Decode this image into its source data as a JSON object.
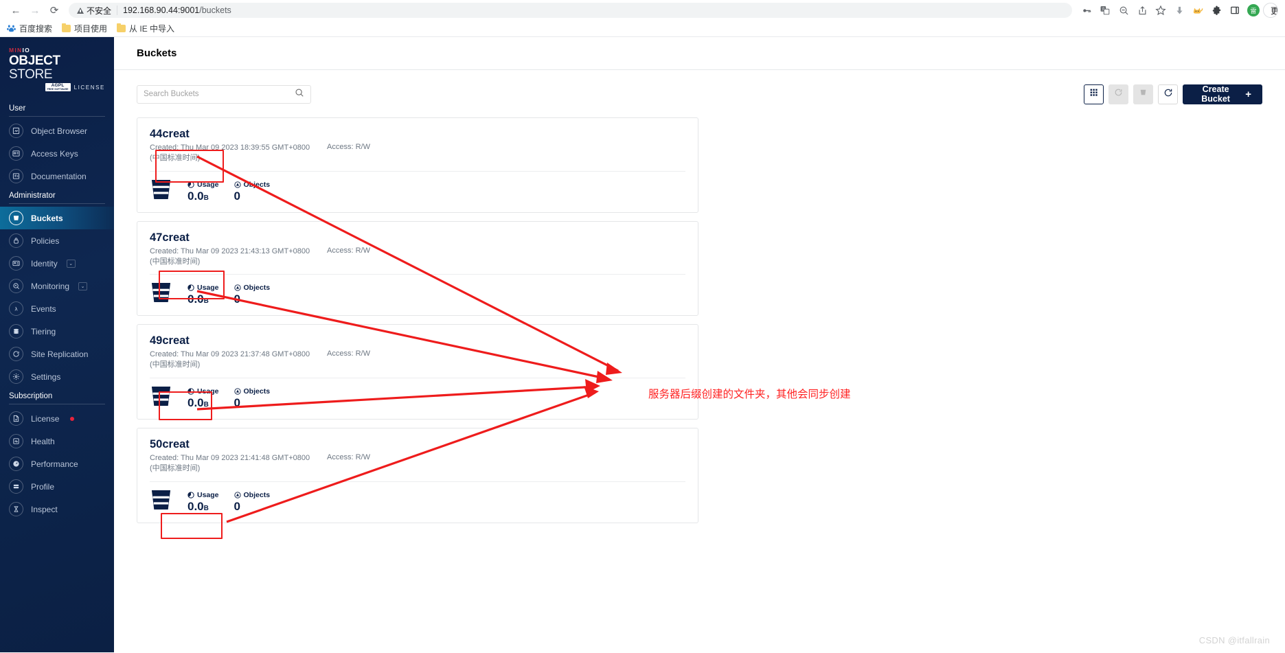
{
  "browser": {
    "nav": {
      "back": "←",
      "forward": "→",
      "reload": "⟳"
    },
    "omnibox": {
      "security_label": "不安全",
      "url_host": "192.168.90.44:9001",
      "url_path": "/buckets"
    },
    "toolbar_icons": [
      {
        "name": "password-key-icon",
        "glyph": "⚷"
      },
      {
        "name": "translate-icon",
        "glyph": "文"
      },
      {
        "name": "zoom-out-icon",
        "glyph": "⊖"
      },
      {
        "name": "share-icon",
        "glyph": "↗"
      },
      {
        "name": "bookmark-star-icon",
        "glyph": "☆"
      },
      {
        "name": "downloads-icon",
        "glyph": "⬇"
      },
      {
        "name": "cat-extension-icon",
        "glyph": "🐈"
      },
      {
        "name": "extensions-puzzle-icon",
        "glyph": "🧩"
      },
      {
        "name": "side-panel-icon",
        "glyph": "◫"
      },
      {
        "name": "profile-avatar-icon",
        "glyph": "雷"
      }
    ],
    "update_button": "更新",
    "bookmarks": [
      {
        "label": "百度搜索",
        "icon": "baidu-icon"
      },
      {
        "label": "项目使用",
        "icon": "folder-icon"
      },
      {
        "label": "从 IE 中导入",
        "icon": "folder-icon"
      }
    ]
  },
  "sidebar": {
    "logo": {
      "brand_small": "MINIO",
      "brand_bold": "OBJECT",
      "brand_light": "STORE",
      "badge": "AGPL",
      "badge_sub": "FREE SOFTWARE",
      "license": "LICENSE"
    },
    "sections": [
      {
        "title": "User",
        "items": [
          {
            "label": "Object Browser",
            "icon": "object-browser-icon",
            "active": false
          },
          {
            "label": "Access Keys",
            "icon": "access-keys-icon",
            "active": false
          },
          {
            "label": "Documentation",
            "icon": "documentation-icon",
            "active": false
          }
        ]
      },
      {
        "title": "Administrator",
        "items": [
          {
            "label": "Buckets",
            "icon": "bucket-icon",
            "active": true
          },
          {
            "label": "Policies",
            "icon": "policies-lock-icon",
            "active": false
          },
          {
            "label": "Identity",
            "icon": "identity-icon",
            "active": false,
            "expandable": true
          },
          {
            "label": "Monitoring",
            "icon": "monitoring-icon",
            "active": false,
            "expandable": true
          },
          {
            "label": "Events",
            "icon": "events-lambda-icon",
            "active": false
          },
          {
            "label": "Tiering",
            "icon": "tiering-layers-icon",
            "active": false
          },
          {
            "label": "Site Replication",
            "icon": "site-replication-icon",
            "active": false
          },
          {
            "label": "Settings",
            "icon": "settings-gear-icon",
            "active": false
          }
        ]
      },
      {
        "title": "Subscription",
        "items": [
          {
            "label": "License",
            "icon": "license-icon",
            "active": false,
            "badge_dot": true
          },
          {
            "label": "Health",
            "icon": "health-icon",
            "active": false
          },
          {
            "label": "Performance",
            "icon": "performance-icon",
            "active": false
          },
          {
            "label": "Profile",
            "icon": "profile-icon",
            "active": false
          },
          {
            "label": "Inspect",
            "icon": "inspect-icon",
            "active": false
          }
        ]
      }
    ]
  },
  "page": {
    "title": "Buckets"
  },
  "toolbar": {
    "search_placeholder": "Search Buckets",
    "search_value": "",
    "search_icon": "search-icon",
    "buttons": [
      {
        "name": "grid-view-button",
        "icon": "grid-icon",
        "state": "active"
      },
      {
        "name": "refresh-replication-button",
        "icon": "sync-icon",
        "state": "disabled"
      },
      {
        "name": "delete-bucket-button",
        "icon": "trash-bucket-icon",
        "state": "disabled"
      },
      {
        "name": "reload-button",
        "icon": "reload-icon",
        "state": "normal"
      }
    ],
    "create_label": "Create Bucket",
    "create_plus": "+"
  },
  "buckets": [
    {
      "name": "44creat",
      "created": "Created: Thu Mar 09 2023 18:39:55 GMT+0800",
      "created_tz": "(中国标准时间)",
      "access": "Access: R/W",
      "usage_label": "Usage",
      "usage_value": "0.0",
      "usage_unit": "B",
      "objects_label": "Objects",
      "objects_value": "0"
    },
    {
      "name": "47creat",
      "created": "Created: Thu Mar 09 2023 21:43:13 GMT+0800",
      "created_tz": "(中国标准时间)",
      "access": "Access: R/W",
      "usage_label": "Usage",
      "usage_value": "0.0",
      "usage_unit": "B",
      "objects_label": "Objects",
      "objects_value": "0"
    },
    {
      "name": "49creat",
      "created": "Created: Thu Mar 09 2023 21:37:48 GMT+0800",
      "created_tz": "(中国标准时间)",
      "access": "Access: R/W",
      "usage_label": "Usage",
      "usage_value": "0.0",
      "usage_unit": "B",
      "objects_label": "Objects",
      "objects_value": "0"
    },
    {
      "name": "50creat",
      "created": "Created: Thu Mar 09 2023 21:41:48 GMT+0800",
      "created_tz": "(中国标准时间)",
      "access": "Access: R/W",
      "usage_label": "Usage",
      "usage_value": "0.0",
      "usage_unit": "B",
      "objects_label": "Objects",
      "objects_value": "0"
    }
  ],
  "annotation": {
    "note_text": "服务器后缀创建的文件夹，其他会同步创建",
    "color": "#ff2222"
  },
  "watermark": {
    "text": "CSDN @itfallrain"
  }
}
